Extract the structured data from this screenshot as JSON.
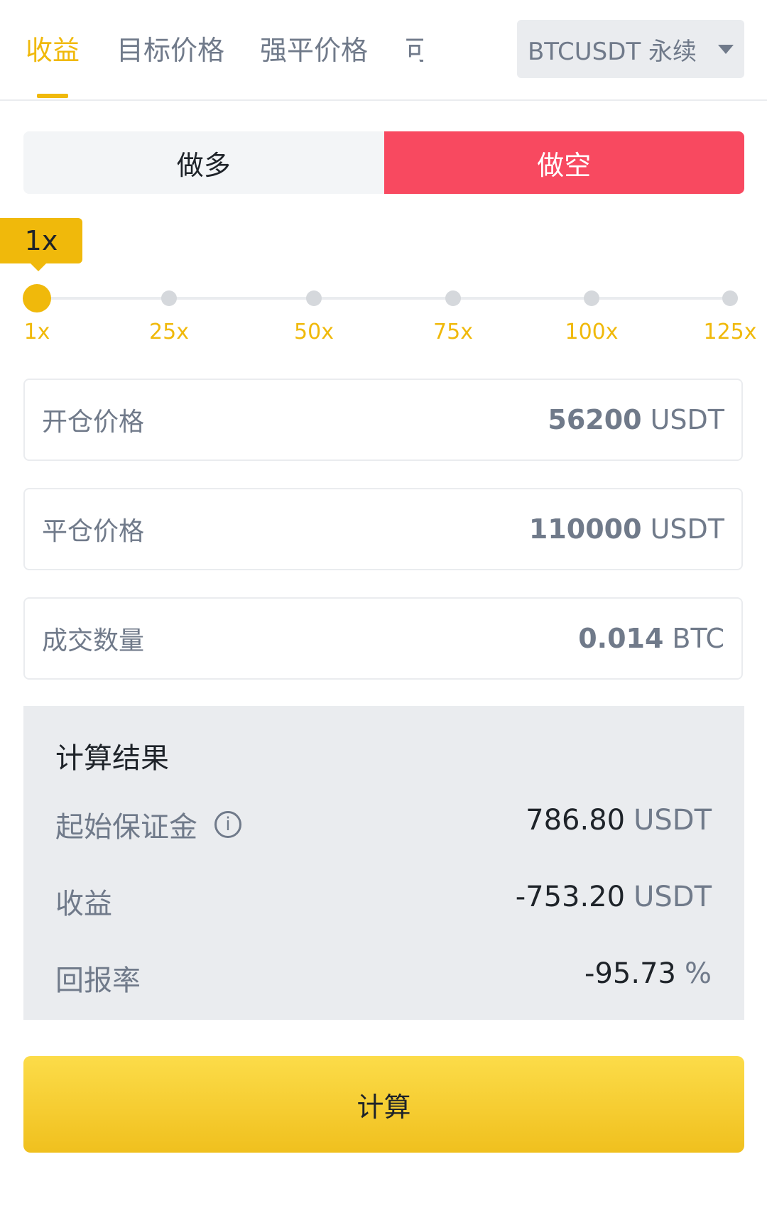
{
  "tabs": [
    {
      "label": "收益",
      "active": true
    },
    {
      "label": "目标价格",
      "active": false
    },
    {
      "label": "强平价格",
      "active": false
    },
    {
      "label": "可",
      "active": false
    }
  ],
  "symbol_select": {
    "value": "BTCUSDT 永续",
    "icon": "caret-down-icon"
  },
  "direction": {
    "long_label": "做多",
    "short_label": "做空",
    "selected": "short"
  },
  "leverage": {
    "current": "1x",
    "marks": [
      "1x",
      "25x",
      "50x",
      "75x",
      "100x",
      "125x"
    ]
  },
  "inputs": {
    "entry_price": {
      "label": "开仓价格",
      "value": "56200",
      "unit": "USDT"
    },
    "exit_price": {
      "label": "平仓价格",
      "value": "110000",
      "unit": "USDT"
    },
    "quantity": {
      "label": "成交数量",
      "value": "0.014",
      "unit": "BTC"
    }
  },
  "results": {
    "title": "计算结果",
    "initial_margin": {
      "label": "起始保证金",
      "value": "786.80",
      "unit": "USDT",
      "info_icon": "i"
    },
    "pnl": {
      "label": "收益",
      "value": "-753.20",
      "unit": "USDT"
    },
    "roe": {
      "label": "回报率",
      "value": "-95.73",
      "unit": "%"
    }
  },
  "calculate_button": "计算",
  "colors": {
    "accent": "#f0b90b",
    "short": "#f84960",
    "muted": "#707a8a"
  }
}
